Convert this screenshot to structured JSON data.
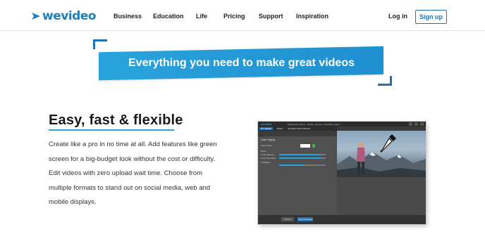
{
  "nav": {
    "logo_text": "wevideo",
    "links": [
      "Business",
      "Education",
      "Life",
      "Pricing",
      "Support",
      "Inspiration"
    ],
    "login_label": "Log in",
    "signup_label": "Sign up"
  },
  "banner": {
    "text": "Everything you need to make great videos"
  },
  "feature": {
    "heading": "Easy, fast & flexible",
    "lines": [
      "Create like a pro in no time at all. Add features like green",
      "screen for a big-budget look without the cost or difficulty.",
      "Edit videos with zero upload wait time. Choose from",
      "multiple formats to stand out on social media, web and",
      "mobile displays."
    ]
  },
  "mock_app": {
    "logo": "wevideo",
    "menu": [
      "Dashboard",
      "Videos",
      "Media",
      "Explore",
      "Templates",
      "Admin"
    ],
    "tabs": [
      "MY MEDIA",
      "VIDEO",
      "SHARED RESOURCES"
    ],
    "panel_title": "Color Keying",
    "labels": [
      "Select color",
      "Blend",
      "Color Balance",
      "Color Sensitivity",
      "Spill/Edge"
    ],
    "slider_levels": [
      0.9,
      0.9,
      0.55
    ],
    "cancel_label": "Cancel",
    "apply_label": "Apply Changes"
  },
  "colors": {
    "brand_blue": "#1e73b8",
    "banner_blue": "#2aa3dc",
    "text_dark": "#222222"
  }
}
